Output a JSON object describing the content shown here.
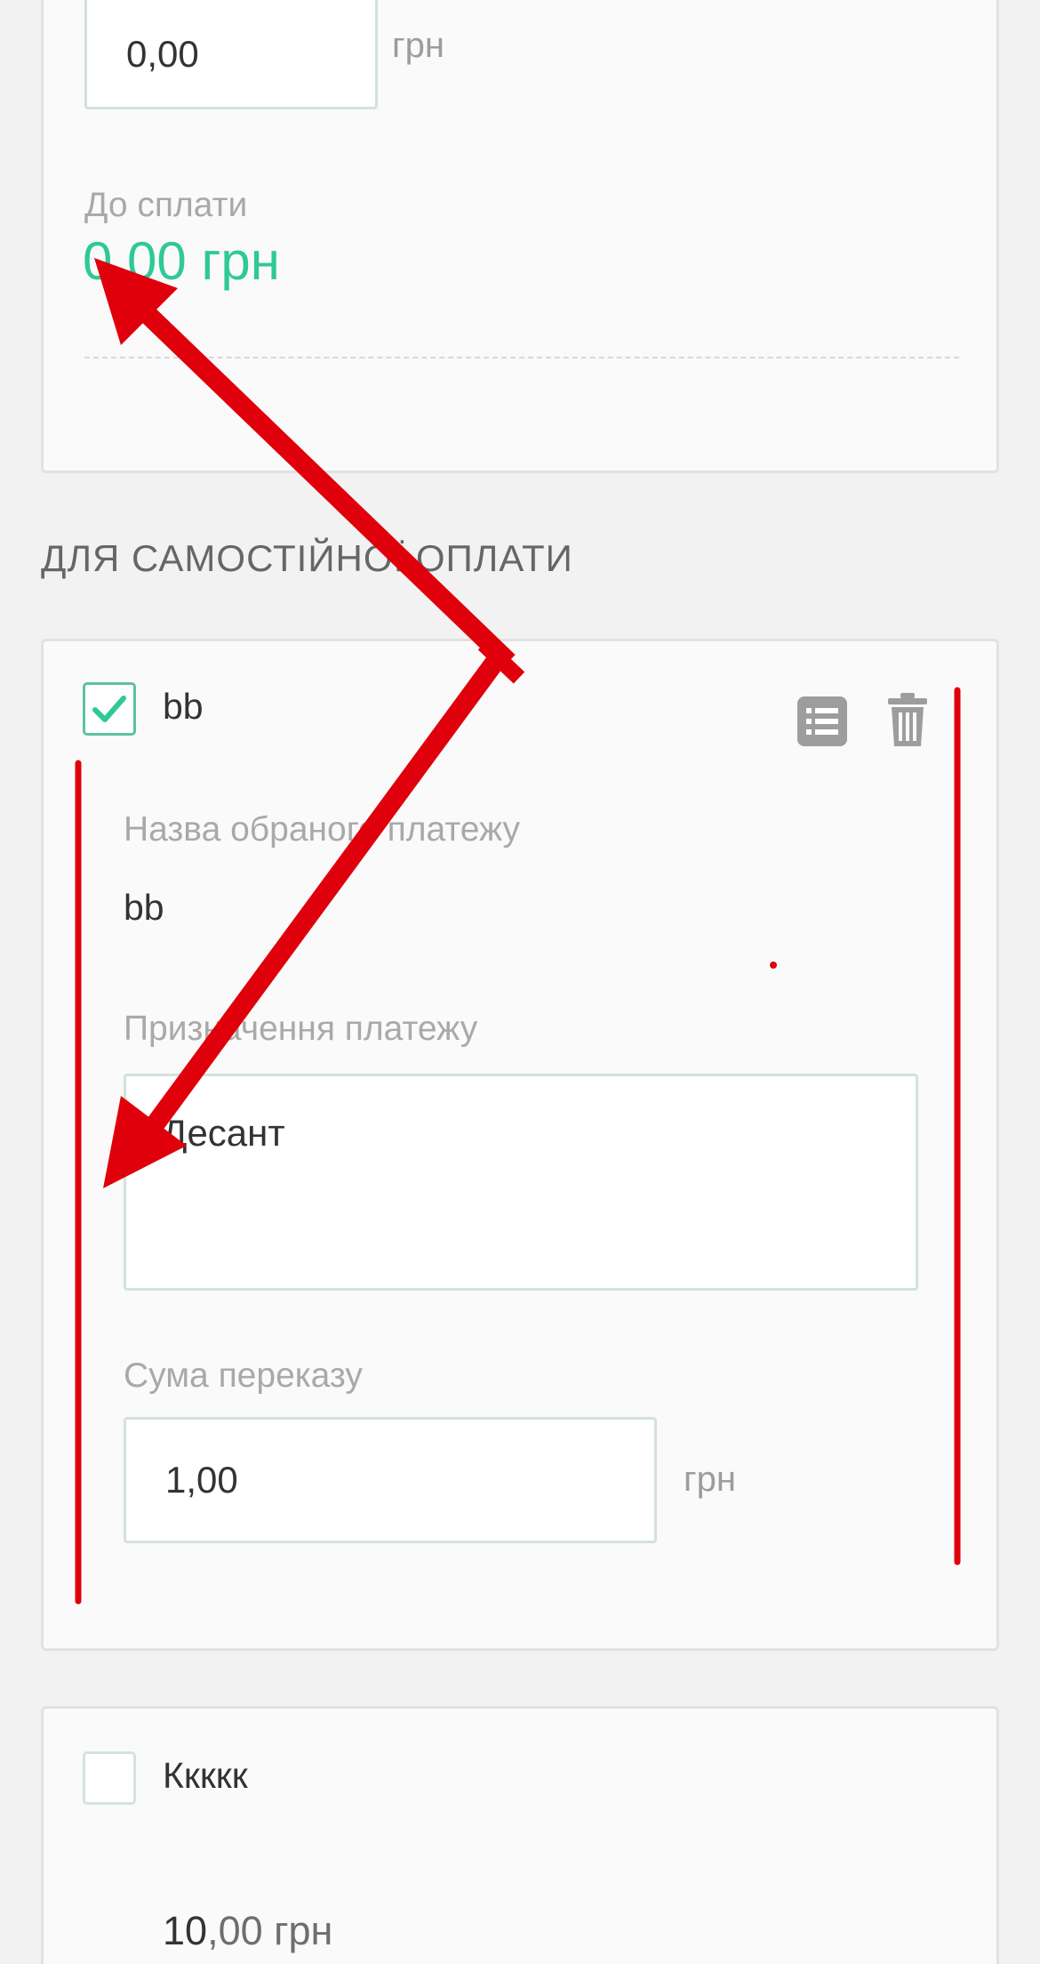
{
  "top_card": {
    "amount_value": "0,00",
    "amount_unit": "грн",
    "to_pay_label": "До сплати",
    "to_pay_value": "0,00 грн"
  },
  "self_pay_section": {
    "title": "ДЛЯ САМОСТІЙНОЇ ОПЛАТИ"
  },
  "payment_bb": {
    "name": "bb",
    "checked": true,
    "selected_name_label": "Назва обраного платежу",
    "selected_name_value": "bb",
    "purpose_label": "Призначення платежу",
    "purpose_value": "Десант",
    "amount_label": "Сума переказу",
    "amount_value": "1,00",
    "amount_unit": "грн",
    "list_icon": "list-icon",
    "trash_icon": "trash-icon"
  },
  "payment_kkkk": {
    "name": "Ккккк",
    "checked": false,
    "amount_int": "10",
    "amount_frac": ",00 грн"
  },
  "colors": {
    "accent_green": "#2ec997",
    "checkbox_border": "#5cc2a0",
    "annotation_red": "#e0000b"
  }
}
